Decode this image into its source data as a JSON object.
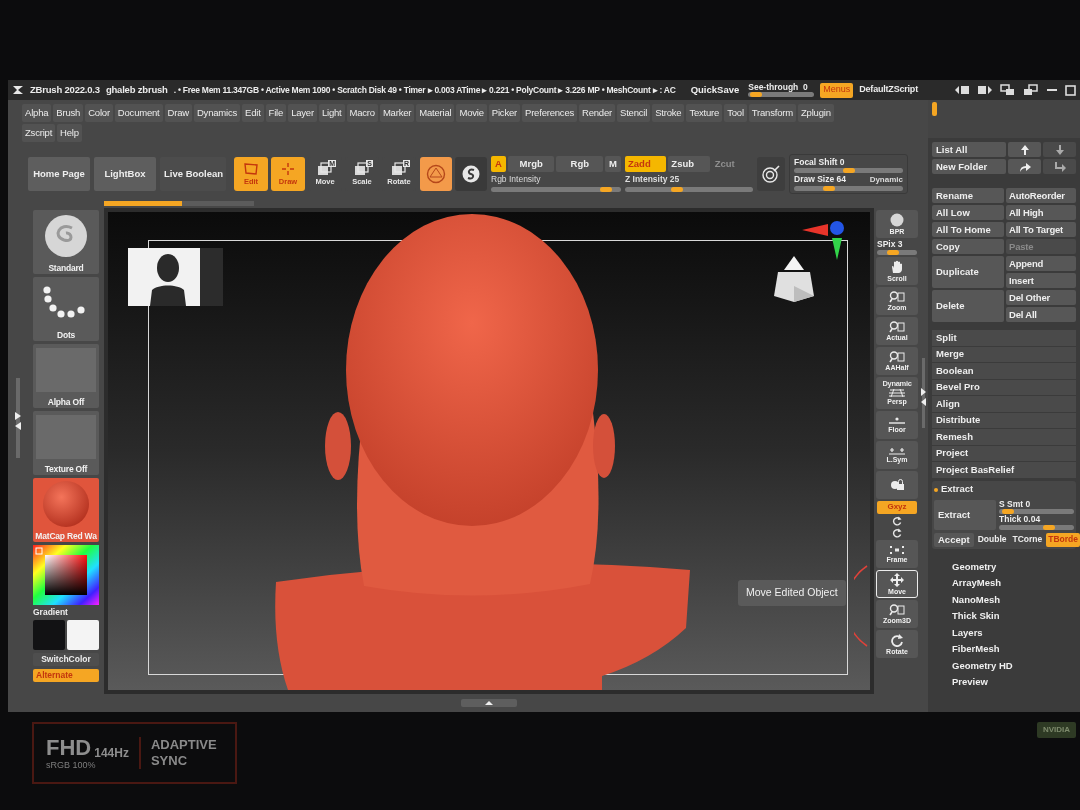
{
  "title_bar": {
    "app": "ZBrush 2022.0.3",
    "project": "ghaleb zbrush",
    "stats": ". • Free Mem 11.347GB • Active Mem 1090 • Scratch Disk 49 • Timer ▸ 0.003 ATime ▸ 0.221 • PolyCount ▸ 3.226 MP • MeshCount ▸ : AC",
    "quicksave": "QuickSave",
    "see_through": {
      "label": "See-through  0",
      "level": 0.03
    },
    "menus": {
      "label": "Menus",
      "selected": true
    },
    "script": "DefaultZScript"
  },
  "menu_rows": [
    [
      "Alpha",
      "Brush",
      "Color",
      "Document",
      "Draw",
      "Dynamics",
      "Edit",
      "File",
      "Layer",
      "Light",
      "Macro",
      "Marker",
      "Material",
      "Movie",
      "Picker",
      "Preferences",
      "Render",
      "Stencil",
      "Stroke",
      "Texture",
      "Tool",
      "Transform",
      "Zplugin"
    ],
    [
      "Zscript",
      "Help"
    ]
  ],
  "toolbar": {
    "tabs": [
      {
        "kind": "button",
        "label": "Home Page"
      },
      {
        "kind": "button",
        "label": "LightBox"
      },
      {
        "kind": "toggle",
        "label": "Live Boolean",
        "on": false
      }
    ],
    "modes": [
      {
        "kind": "edit",
        "label": "Edit",
        "selected": true
      },
      {
        "kind": "draw",
        "label": "Draw",
        "selected": true
      },
      {
        "kind": "move",
        "label": "Move",
        "badge": "M",
        "selected": false
      },
      {
        "kind": "scale",
        "label": "Scale",
        "badge": "S",
        "selected": false
      },
      {
        "kind": "rotate",
        "label": "Rotate",
        "badge": "R",
        "selected": false
      }
    ],
    "spheres": [
      {
        "kind": "sculptris",
        "selected": true
      },
      {
        "kind": "swirl",
        "selected": false
      }
    ],
    "color_modes": [
      {
        "label": "A",
        "selected": true
      },
      {
        "label": "Mrgb",
        "selected": false
      },
      {
        "label": "Rgb",
        "selected": false
      },
      {
        "label": "M",
        "selected": false
      }
    ],
    "rgb_intensity": {
      "label": "Rgb Intensity",
      "level": 0.92
    },
    "z_modes": [
      {
        "label": "Zadd",
        "selected": true,
        "disabled": false
      },
      {
        "label": "Zsub",
        "selected": false,
        "disabled": false
      },
      {
        "label": "Zcut",
        "selected": false,
        "disabled": true
      }
    ],
    "z_intensity": {
      "label": "Z Intensity 25",
      "level": 0.4
    },
    "focal_shift": {
      "label": "Focal Shift 0",
      "level": 0.5
    },
    "draw_size": {
      "label": "Draw Size 64",
      "level": 0.3
    },
    "dynamic": "Dynamic"
  },
  "progress": {
    "level": 0.52
  },
  "left_shelf": {
    "items": [
      {
        "kind": "brush",
        "label": "Standard"
      },
      {
        "kind": "stroke",
        "label": "Dots"
      },
      {
        "kind": "alpha",
        "label": "Alpha Off"
      },
      {
        "kind": "texture",
        "label": "Texture Off"
      },
      {
        "kind": "material",
        "label": "MatCap Red Wa"
      }
    ],
    "gradient": "Gradient",
    "swatches": [
      {
        "color": "#121214"
      },
      {
        "color": "#f4f4f4"
      }
    ],
    "switch_color": "SwitchColor",
    "alternate": {
      "label": "Alternate",
      "on": true
    }
  },
  "canvas": {
    "tooltip": "Move Edited Object"
  },
  "right_shelf": [
    {
      "kind": "bpr",
      "label": "BPR",
      "selected": false
    },
    {
      "kind": "slider",
      "label": "SPix 3",
      "level": 0.35
    },
    {
      "kind": "scroll",
      "label": "Scroll",
      "selected": false
    },
    {
      "kind": "zoom",
      "label": "Zoom",
      "selected": false
    },
    {
      "kind": "actual",
      "label": "Actual",
      "selected": false
    },
    {
      "kind": "aahalf",
      "label": "AAHalf",
      "selected": false
    },
    {
      "kind": "persp",
      "label": "Persp",
      "caption": "Dynamic",
      "selected": false
    },
    {
      "kind": "floor",
      "label": "Floor",
      "selected": false
    },
    {
      "kind": "lsym",
      "label": "L.Sym",
      "selected": false
    },
    {
      "kind": "lock",
      "selected": false
    },
    {
      "kind": "gxyz",
      "label": "Gxyz",
      "on": true
    },
    {
      "kind": "small"
    },
    {
      "kind": "small"
    },
    {
      "kind": "frame",
      "label": "Frame",
      "selected": false
    },
    {
      "kind": "move",
      "label": "Move",
      "selected": true
    },
    {
      "kind": "zoom3d",
      "label": "Zoom3D",
      "selected": false
    },
    {
      "kind": "rotate",
      "label": "Rotate",
      "selected": false
    }
  ],
  "right_panel": {
    "list_all": "List All",
    "new_folder": "New Folder",
    "action_grid": [
      {
        "left": "Rename",
        "right": [
          {
            "label": "AutoReorder",
            "disabled": false
          }
        ]
      },
      {
        "left": "All Low",
        "right": [
          {
            "label": "All High",
            "disabled": false
          }
        ]
      },
      {
        "left": "All To Home",
        "right": [
          {
            "label": "All To Target",
            "disabled": false
          }
        ]
      },
      {
        "left": "Copy",
        "right": [
          {
            "label": "Paste",
            "disabled": true
          }
        ]
      },
      {
        "left": "Duplicate",
        "right": [
          {
            "label": "Append",
            "disabled": false
          },
          {
            "label": "Insert",
            "disabled": false
          }
        ]
      },
      {
        "left": "Delete",
        "right": [
          {
            "label": "Del Other",
            "disabled": false
          },
          {
            "label": "Del All",
            "disabled": false
          }
        ]
      }
    ],
    "commands": [
      "Split",
      "Merge",
      "Boolean",
      "Bevel Pro",
      "Align",
      "Distribute",
      "Remesh",
      "Project",
      "Project BasRelief"
    ],
    "extract": {
      "title": "Extract",
      "expanded": true,
      "button": "Extract",
      "s_smt": {
        "label": "S Smt 0",
        "level": 0.05
      },
      "thick": {
        "label": "Thick 0.04",
        "level": 0.7
      },
      "options": [
        {
          "kind": "button",
          "label": "Accept"
        },
        {
          "kind": "toggle",
          "label": "Double",
          "on": false
        },
        {
          "kind": "toggle",
          "label": "TCorne",
          "on": false
        },
        {
          "kind": "toggle",
          "label": "TBorde",
          "on": true
        }
      ]
    },
    "subpalettes": [
      "Geometry",
      "ArrayMesh",
      "NanoMesh",
      "Thick Skin",
      "Layers",
      "FiberMesh",
      "Geometry HD",
      "Preview"
    ]
  },
  "bezel": {
    "resolution": "FHD",
    "refresh": "144Hz",
    "gamut": "sRGB 100%",
    "sync": "ADAPTIVE SYNC"
  },
  "sticker": "NVIDIA"
}
